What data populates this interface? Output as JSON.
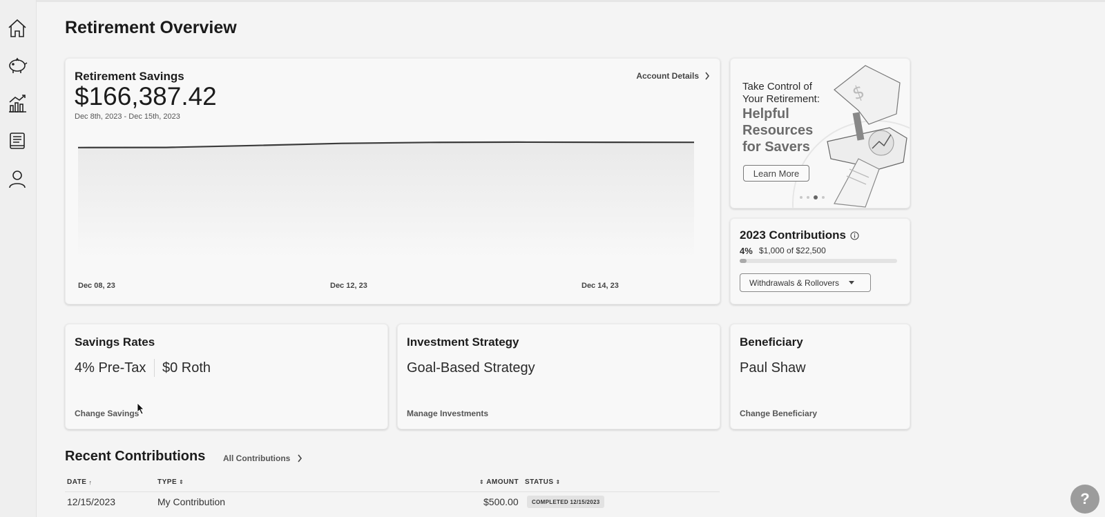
{
  "page": {
    "title": "Retirement Overview"
  },
  "sidebar": {
    "items": [
      {
        "icon": "home-icon"
      },
      {
        "icon": "piggy-bank-icon"
      },
      {
        "icon": "growth-chart-icon"
      },
      {
        "icon": "book-icon"
      },
      {
        "icon": "user-icon"
      }
    ]
  },
  "savings_card": {
    "title": "Retirement Savings",
    "amount": "$166,387.42",
    "date_range": "Dec 8th, 2023 - Dec 15th, 2023",
    "account_link": "Account Details"
  },
  "chart_data": {
    "type": "area",
    "x": [
      "Dec 08, 23",
      "Dec 12, 23",
      "Dec 14, 23"
    ],
    "x_tick_labels": [
      "Dec 08, 23",
      "Dec 12, 23",
      "Dec 14, 23"
    ],
    "note_values": "y axis not labeled; line nearly flat, rising slightly",
    "series": [
      {
        "values": [
          0.02,
          0.05,
          0.35,
          0.7,
          0.85,
          0.9,
          0.88,
          0.87
        ]
      }
    ],
    "grid": false
  },
  "promo": {
    "line1": "Take Control of",
    "line2": "Your Retirement:",
    "headline1": "Helpful",
    "headline2": "Resources",
    "headline3": "for Savers",
    "button": "Learn More",
    "carousel_index": 3,
    "carousel_count": 4
  },
  "contributions": {
    "title": "2023 Contributions",
    "percent": "4%",
    "detail": "$1,000 of $22,500",
    "progress_fraction": 0.044,
    "dropdown": "Withdrawals & Rollovers"
  },
  "savings_rates": {
    "title": "Savings Rates",
    "pretax": "4% Pre-Tax",
    "roth": "$0 Roth",
    "link": "Change Savings"
  },
  "investment": {
    "title": "Investment Strategy",
    "value": "Goal-Based Strategy",
    "link": "Manage Investments"
  },
  "beneficiary": {
    "title": "Beneficiary",
    "value": "Paul Shaw",
    "link": "Change Beneficiary"
  },
  "recent": {
    "title": "Recent Contributions",
    "all_link": "All Contributions",
    "columns": {
      "date": "DATE",
      "type": "TYPE",
      "amount": "AMOUNT",
      "status": "STATUS"
    },
    "rows": [
      {
        "date": "12/15/2023",
        "type": "My Contribution",
        "amount": "$500.00",
        "status": "COMPLETED 12/15/2023"
      }
    ]
  },
  "help": {
    "label": "?"
  }
}
